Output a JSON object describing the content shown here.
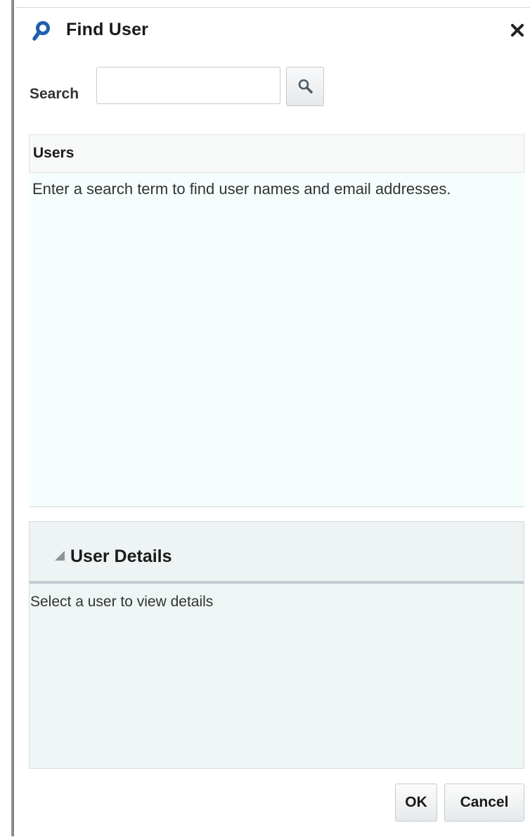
{
  "dialog": {
    "title": "Find User",
    "title_icon": "search-icon",
    "close_icon": "close-icon"
  },
  "search": {
    "label": "Search",
    "value": "",
    "placeholder": "",
    "button_icon": "magnifier-icon"
  },
  "users": {
    "header": "Users",
    "empty_message": "Enter a search term to find user names and email addresses."
  },
  "details": {
    "header": "User Details",
    "expanded": true,
    "empty_message": "Select a user to view details"
  },
  "buttons": {
    "ok_label": "OK",
    "cancel_label": "Cancel"
  },
  "colors": {
    "accent": "#1f5fb0",
    "users_background": "#f5fdfd",
    "details_background": "#eef5f5"
  }
}
